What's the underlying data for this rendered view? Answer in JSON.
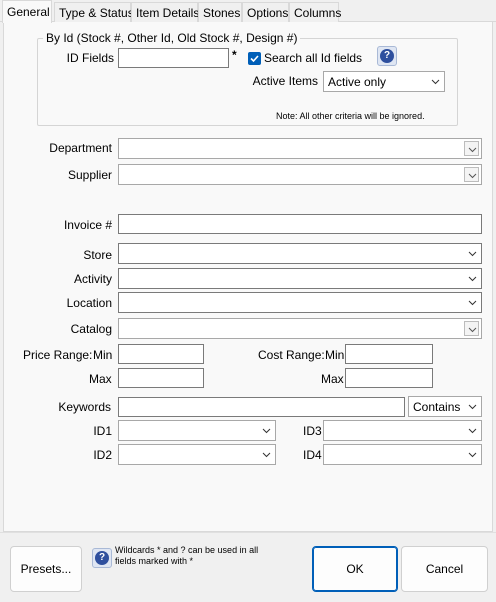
{
  "tabs": [
    {
      "label": "General",
      "active": true
    },
    {
      "label": "Type & Status",
      "active": false
    },
    {
      "label": "Item Details",
      "active": false
    },
    {
      "label": "Stones",
      "active": false
    },
    {
      "label": "Options",
      "active": false
    },
    {
      "label": "Columns",
      "active": false
    }
  ],
  "by_id": {
    "legend": "By Id  (Stock #, Other Id, Old Stock #, Design #)",
    "id_fields_label": "ID Fields",
    "id_fields_value": "",
    "asterisk": "*",
    "search_all_label": "Search all Id fields",
    "search_all_checked": true,
    "active_items_label": "Active Items",
    "active_items_value": "Active only",
    "note": "Note: All other criteria will be ignored."
  },
  "fields": {
    "department_label": "Department",
    "department_value": "",
    "supplier_label": "Supplier",
    "supplier_value": "",
    "invoice_label": "Invoice #",
    "invoice_value": "",
    "store_label": "Store",
    "store_value": "",
    "activity_label": "Activity",
    "activity_value": "",
    "location_label": "Location",
    "location_value": "",
    "catalog_label": "Catalog",
    "catalog_value": "",
    "price_range_label": "Price Range:",
    "min_label": "Min",
    "max_label": "Max",
    "price_min": "",
    "price_max": "",
    "cost_range_label": "Cost Range:",
    "cost_min": "",
    "cost_max": "",
    "keywords_label": "Keywords",
    "keywords_value": "",
    "keywords_mode": "Contains",
    "id1_label": "ID1",
    "id2_label": "ID2",
    "id3_label": "ID3",
    "id4_label": "ID4",
    "id1_value": "",
    "id2_value": "",
    "id3_value": "",
    "id4_value": ""
  },
  "footer": {
    "presets_label": "Presets...",
    "wildcard_note": "Wildcards * and ? can be used in all fields marked with *",
    "ok_label": "OK",
    "cancel_label": "Cancel"
  },
  "colors": {
    "accent": "#005fb8",
    "panel": "#f9f9f9",
    "window": "#f0f0f0"
  }
}
